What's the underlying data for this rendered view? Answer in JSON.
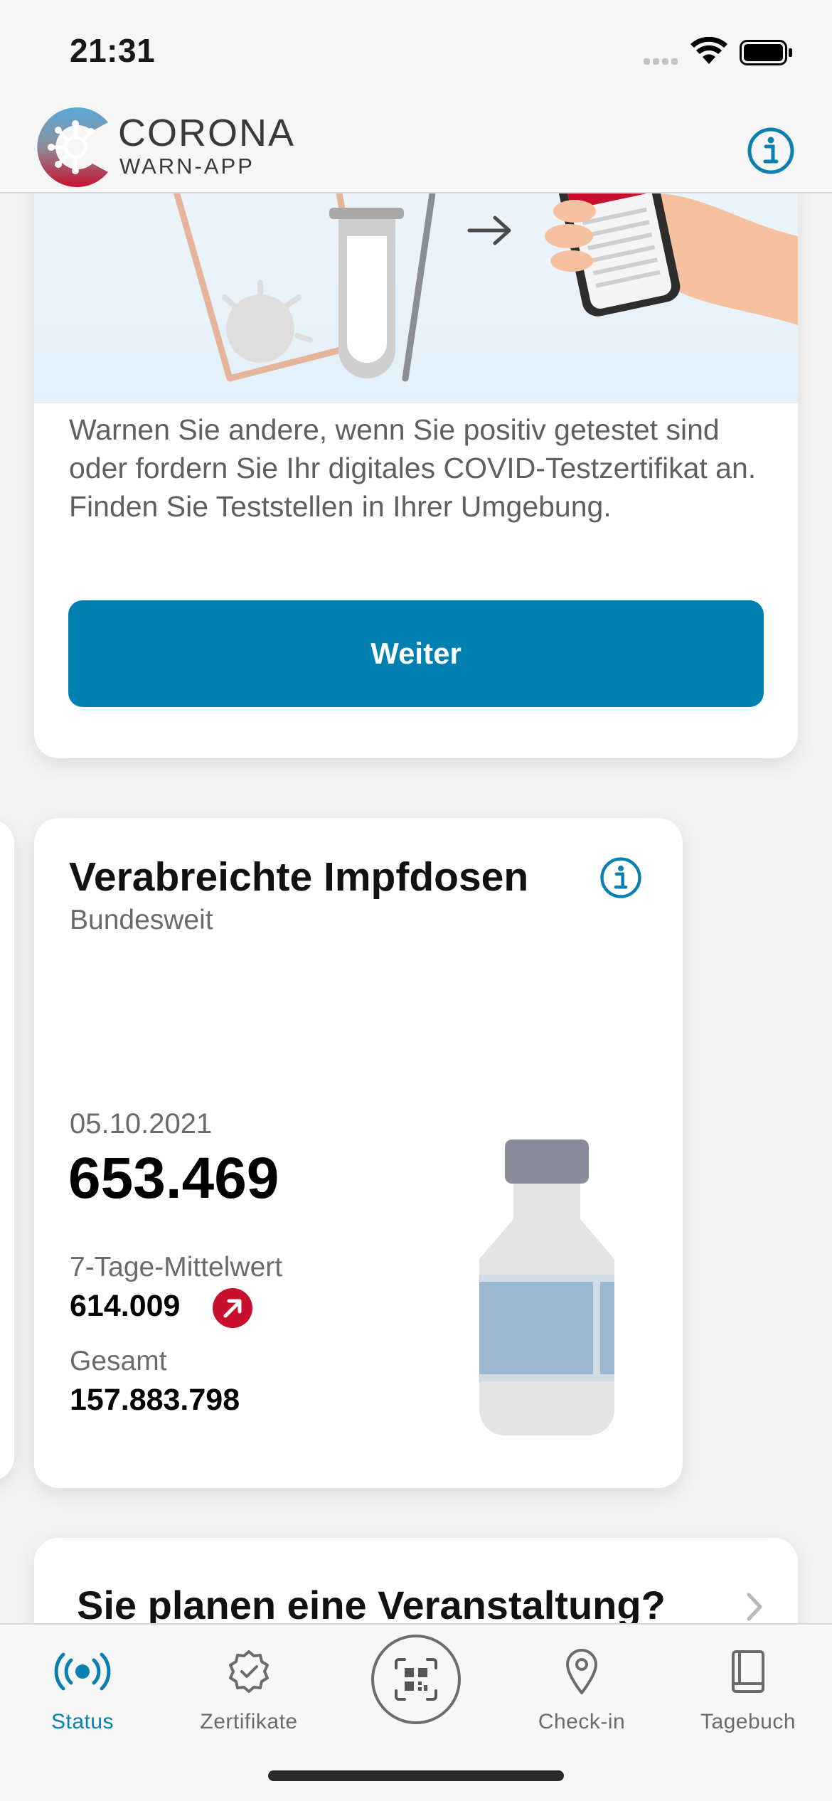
{
  "status_bar": {
    "time": "21:31",
    "icons": [
      "cellular-signal-icon",
      "wifi-icon",
      "battery-icon"
    ]
  },
  "header": {
    "brand_title": "CORONA",
    "brand_subtitle": "WARN-APP",
    "info_icon": "info-icon"
  },
  "test_card": {
    "text": "Warnen Sie andere, wenn Sie positiv getestet sind oder fordern Sie Ihr digitales COVID-Testzertifikat an. Finden Sie Teststellen in Ihrer Umgebung.",
    "button_label": "Weiter"
  },
  "vaccination_card": {
    "title": "Verabreichte Impfdosen",
    "subtitle": "Bundesweit",
    "date": "05.10.2021",
    "value": "653.469",
    "avg_label": "7-Tage-Mittelwert",
    "avg_value": "614.009",
    "avg_trend": "up",
    "total_label": "Gesamt",
    "total_value": "157.883.798"
  },
  "event_card": {
    "title": "Sie planen eine Veranstaltung?"
  },
  "tabbar": {
    "tabs": [
      {
        "label": "Status",
        "icon": "broadcast-icon",
        "active": true
      },
      {
        "label": "Zertifikate",
        "icon": "certificate-icon",
        "active": false
      },
      {
        "label": "",
        "icon": "qr-scan-icon",
        "active": false
      },
      {
        "label": "Check-in",
        "icon": "location-pin-icon",
        "active": false
      },
      {
        "label": "Tagebuch",
        "icon": "book-icon",
        "active": false
      }
    ]
  },
  "colors": {
    "accent": "#0080B0",
    "trend_red": "#C8102E",
    "background": "#F4F4F4"
  }
}
